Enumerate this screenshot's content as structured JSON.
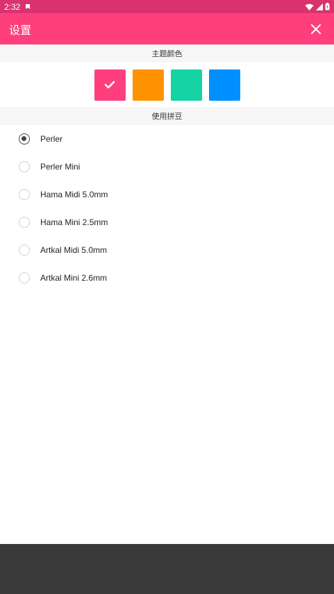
{
  "status_bar": {
    "time": "2:32",
    "icons": [
      "notification-icon",
      "wifi-icon",
      "signal-icon",
      "battery-icon"
    ]
  },
  "app_bar": {
    "title": "设置",
    "close_icon": "close-icon"
  },
  "theme_section": {
    "header": "主题颜色",
    "swatches": [
      {
        "color": "#ff3f7d",
        "selected": true
      },
      {
        "color": "#ff9200",
        "selected": false
      },
      {
        "color": "#15d3a2",
        "selected": false
      },
      {
        "color": "#0090ff",
        "selected": false
      }
    ]
  },
  "beads_section": {
    "header": "使用拼豆",
    "selected_index": 0,
    "options": [
      {
        "label": "Perler"
      },
      {
        "label": "Perler Mini"
      },
      {
        "label": "Hama Midi 5.0mm"
      },
      {
        "label": "Hama Mini 2.5mm"
      },
      {
        "label": "Artkal Midi 5.0mm"
      },
      {
        "label": "Artkal Mini 2.6mm"
      }
    ]
  },
  "colors": {
    "status_bar": "#d9336e",
    "app_bar": "#ff3f7d",
    "section_header_bg": "#f6f6f6",
    "nav_bar": "#3a3a3a"
  }
}
